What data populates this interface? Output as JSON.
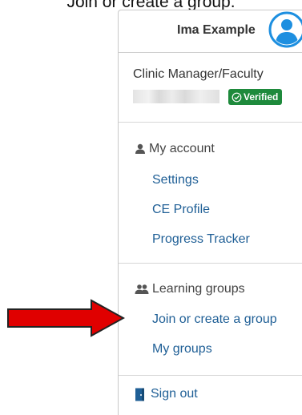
{
  "caption": "Join or create a group.",
  "header": {
    "user_name": "Ima Example",
    "avatar_icon": "user-circle-icon",
    "accent": "#1d8fe0"
  },
  "role": {
    "title": "Clinic Manager/Faculty",
    "badge": "Verified",
    "badge_color": "#1e8a3c"
  },
  "account": {
    "heading": "My account",
    "heading_icon": "person-icon",
    "links": [
      "Settings",
      "CE Profile",
      "Progress Tracker"
    ]
  },
  "groups": {
    "heading": "Learning groups",
    "heading_icon": "people-icon",
    "links": [
      "Join or create a group",
      "My groups"
    ]
  },
  "signout": {
    "label": "Sign out",
    "icon": "door-icon"
  },
  "link_color": "#1f5f96",
  "annotation": {
    "type": "red-arrow",
    "color": "#e00000",
    "points_to": "Join or create a group"
  }
}
